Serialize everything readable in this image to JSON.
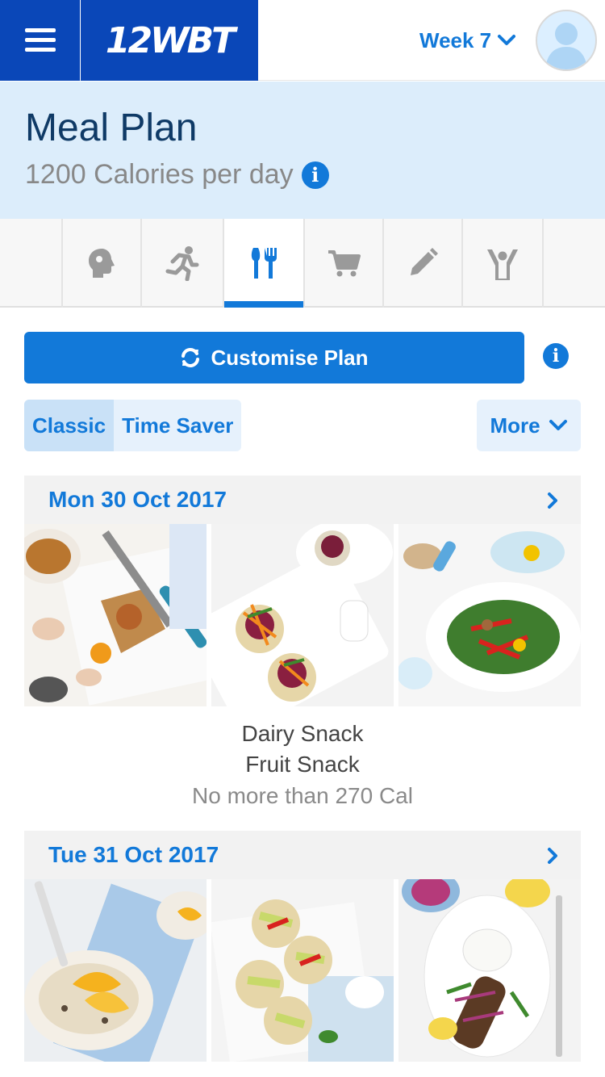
{
  "app": {
    "logo": "12WBT",
    "week_label": "Week 7"
  },
  "header": {
    "title": "Meal Plan",
    "subtitle": "1200 Calories per day"
  },
  "tabs": [
    {
      "icon": "brain-icon",
      "active": false
    },
    {
      "icon": "running-icon",
      "active": false
    },
    {
      "icon": "fork-knife-icon",
      "active": true
    },
    {
      "icon": "cart-icon",
      "active": false
    },
    {
      "icon": "pencil-icon",
      "active": false
    },
    {
      "icon": "trophy-person-icon",
      "active": false
    }
  ],
  "actions": {
    "customise_label": "Customise Plan",
    "seg_classic": "Classic",
    "seg_time_saver": "Time Saver",
    "more_label": "More"
  },
  "days": [
    {
      "date": "Mon 30 Oct 2017",
      "meals": [
        "beans-on-toast",
        "beetroot-crackers",
        "chicken-salad"
      ],
      "snacks": [
        "Dairy Snack",
        "Fruit Snack"
      ],
      "calorie_note": "No more than 270 Cal"
    },
    {
      "date": "Tue 31 Oct 2017",
      "meals": [
        "muesli-mango",
        "tuna-crackers",
        "kofta-plate"
      ]
    }
  ],
  "colors": {
    "brand": "#0a47b8",
    "accent": "#1279d9",
    "band": "#dcedfb"
  }
}
